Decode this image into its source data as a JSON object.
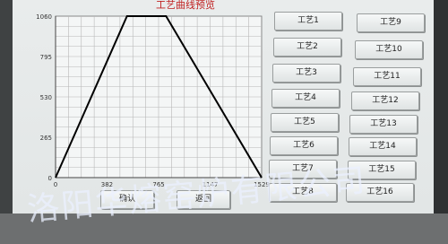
{
  "screen_title": "工艺曲线预览",
  "chart_data": {
    "type": "line",
    "x_ticks": [
      "0",
      "382",
      "765",
      "1147",
      "1529"
    ],
    "y_ticks": [
      "0",
      "265",
      "530",
      "795",
      "1060"
    ],
    "xlim": [
      0,
      1529
    ],
    "ylim": [
      0,
      1060
    ],
    "grid": true,
    "series": [
      {
        "x": [
          0,
          530,
          820,
          1529
        ],
        "y": [
          0,
          1060,
          1060,
          0
        ]
      }
    ]
  },
  "buttons": {
    "confirm": "确认",
    "back": "返回",
    "process": [
      "工艺1",
      "工艺2",
      "工艺3",
      "工艺4",
      "工艺5",
      "工艺6",
      "工艺7",
      "工艺8",
      "工艺9",
      "工艺10",
      "工艺11",
      "工艺12",
      "工艺13",
      "工艺14",
      "工艺15",
      "工艺16"
    ]
  },
  "watermark": "洛阳华熔窑炉有限公司",
  "colors": {
    "line": "#000000",
    "grid": "#b8b8b8",
    "title": "#c02020",
    "background": "#e6e9e9"
  }
}
